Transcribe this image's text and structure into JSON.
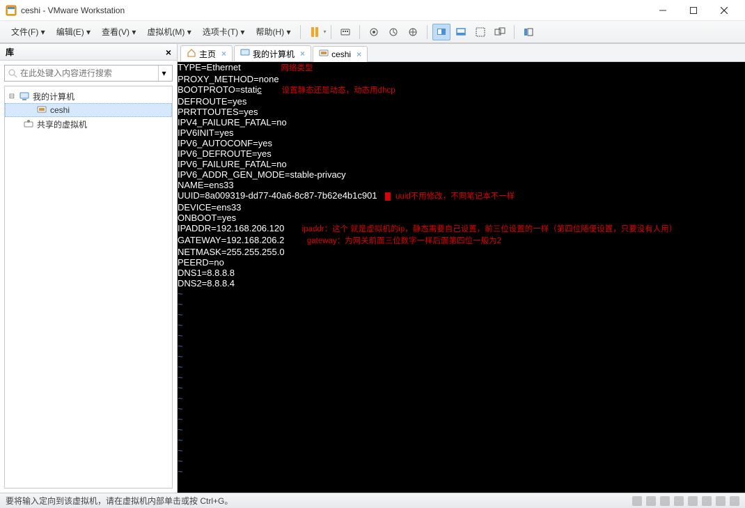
{
  "window": {
    "title": "ceshi - VMware Workstation"
  },
  "menu": {
    "file": "文件(F)",
    "edit": "编辑(E)",
    "view": "查看(V)",
    "vm": "虚拟机(M)",
    "tabs": "选项卡(T)",
    "help": "帮助(H)"
  },
  "library": {
    "title": "库",
    "search_placeholder": "在此处键入内容进行搜索",
    "nodes": {
      "root": "我的计算机",
      "ceshi": "ceshi",
      "shared": "共享的虚拟机"
    }
  },
  "tabs": {
    "home": "主页",
    "mycomp": "我的计算机",
    "ceshi": "ceshi"
  },
  "terminal": {
    "lines": [
      "TYPE=Ethernet",
      "PROXY_METHOD=none",
      "BOOTPROTO=static",
      "DEFROUTE=yes",
      "PRRTTOUTES=yes",
      "IPV4_FAILURE_FATAL=no",
      "IPV6INIT=yes",
      "IPV6_AUTOCONF=yes",
      "IPV6_DEFROUTE=yes",
      "IPV6_FAILURE_FATAL=no",
      "IPV6_ADDR_GEN_MODE=stable-privacy",
      "NAME=ens33",
      "UUID=8a009319-dd77-40a6-8c87-7b62e4b1c901",
      "DEVICE=ens33",
      "ONBOOT=yes",
      "IPADDR=192.168.206.120",
      "GATEWAY=192.168.206.2",
      "NETMASK=255.255.255.0",
      "PEERD=no",
      "DNS1=8.8.8.8",
      "DNS2=8.8.8.4"
    ],
    "annotations": {
      "type": "网络类型",
      "bootproto": "设置静态还是动态，动态用dhcp",
      "uuid": "uuid不用修改，不同笔记本不一样",
      "ipaddr": "ipaddr：这个 就是虚拟机的ip，静态需要自己设置，前三位设置的一样（第四位随便设置，只要没有人用）",
      "gateway": "gateway：为网关前面三位数字一样后面第四位一般为2"
    }
  },
  "status": {
    "text": "要将输入定向到该虚拟机，请在虚拟机内部单击或按 Ctrl+G。"
  }
}
